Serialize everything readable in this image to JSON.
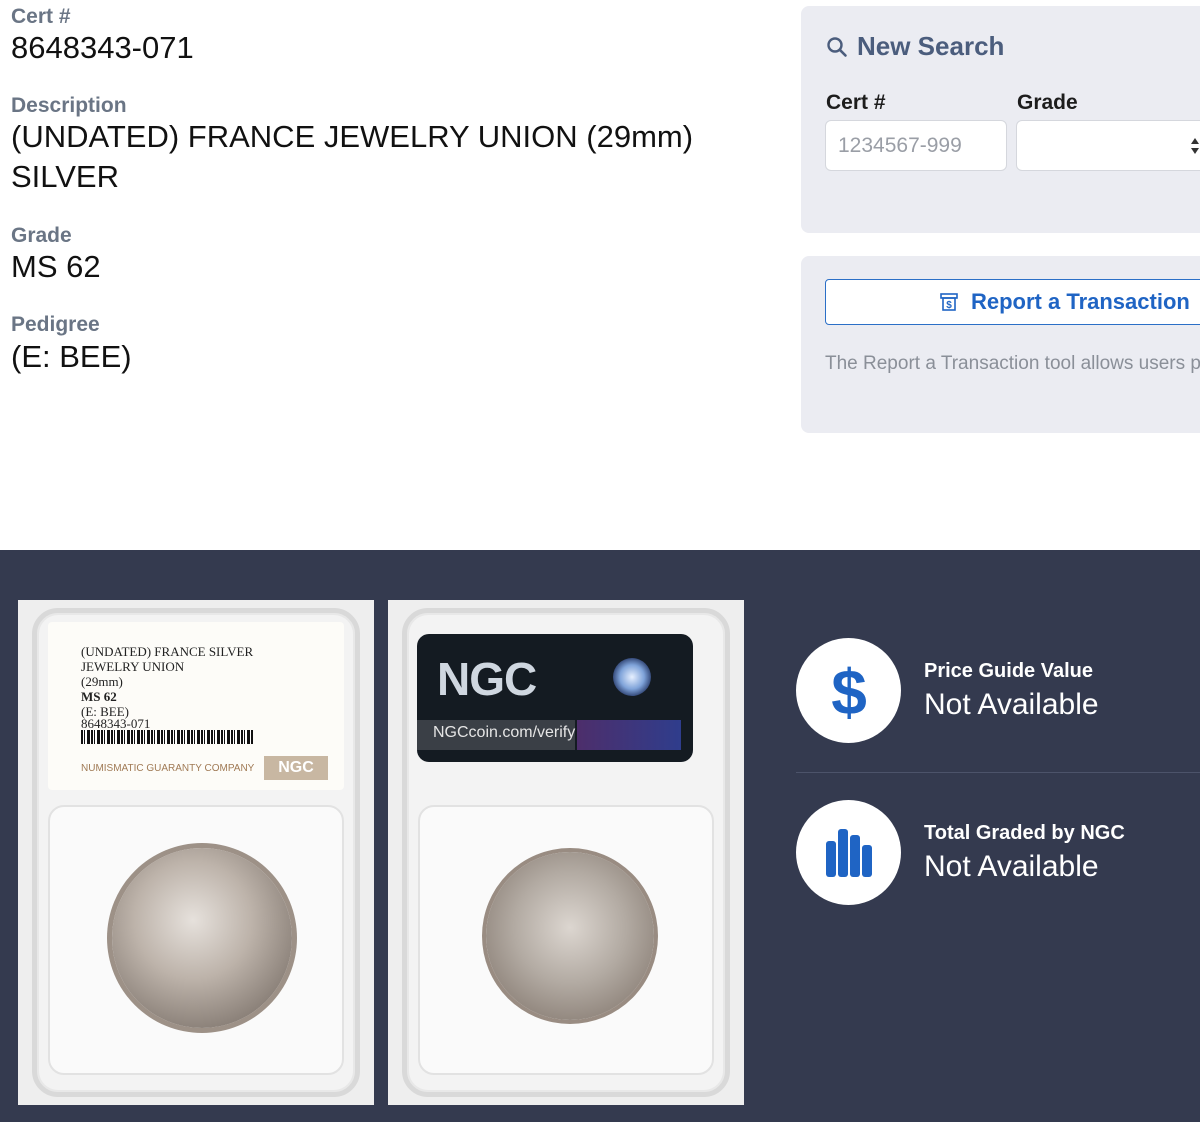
{
  "details": {
    "cert_label": "Cert #",
    "cert_value": "8648343-071",
    "description_label": "Description",
    "description_value": "(UNDATED) FRANCE JEWELRY UNION (29mm) SILVER",
    "grade_label": "Grade",
    "grade_value": "MS 62",
    "pedigree_label": "Pedigree",
    "pedigree_value": "(E: BEE)"
  },
  "search": {
    "title": "New Search",
    "cert_label": "Cert #",
    "cert_placeholder": "1234567-999",
    "grade_label": "Grade",
    "grade_selected": ""
  },
  "report": {
    "button_label": "Report a Transaction",
    "description": "The Report a Transaction tool allows users private or public transactions to our price gu"
  },
  "slab_front_label": {
    "line1": "(UNDATED) FRANCE SILVER",
    "line2": "JEWELRY UNION",
    "line3": "(29mm)",
    "line4": "MS 62",
    "line5": "(E: BEE)",
    "line6": "8648343-071",
    "company": "NUMISMATIC GUARANTY COMPANY",
    "brand": "NGC"
  },
  "slab_back_label": {
    "logo": "NGC",
    "verify": "NGCcoin.com/verify"
  },
  "stats": [
    {
      "title": "Price Guide Value",
      "value": "Not Available",
      "icon": "dollar-icon"
    },
    {
      "title": "Total Graded by NGC",
      "value": "Not Available",
      "icon": "bar-chart-icon"
    }
  ],
  "colors": {
    "label_gray": "#6a7585",
    "accent_blue": "#1f64c4",
    "panel_bg": "#ebecf2",
    "band_bg": "#343a4f"
  }
}
